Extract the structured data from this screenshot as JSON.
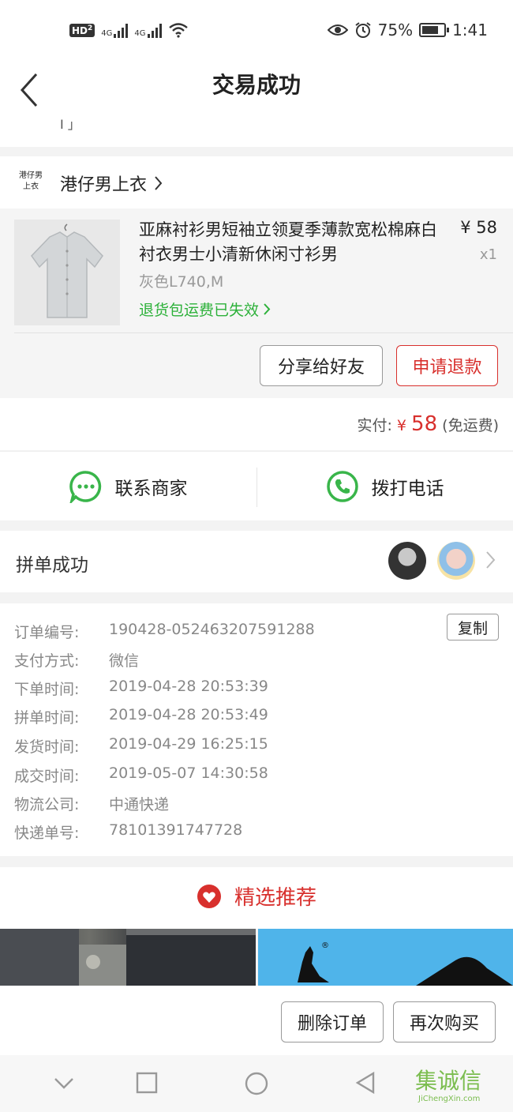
{
  "status_bar": {
    "hd_label": "HD",
    "hd_sub": "2",
    "net1": "4G",
    "net2": "4G",
    "battery_pct_text": "75%",
    "battery_level": 0.75,
    "time": "1:41"
  },
  "nav": {
    "title": "交易成功",
    "subtitle_fragment": "Ⅰ 」"
  },
  "shop": {
    "logo_text": "港仔男上衣",
    "name": "港仔男上衣"
  },
  "goods": {
    "title": "亚麻衬衫男短袖立领夏季薄款宽松棉麻白衬衣男士小清新休闲寸衫男",
    "price": "¥ 58",
    "qty": "x1",
    "spec": "灰色L740,M",
    "return_notice": "退货包运费已失效",
    "share_label": "分享给好友",
    "refund_label": "申请退款"
  },
  "payment": {
    "paid_label": "实付:",
    "currency": "¥",
    "amount": "58",
    "shipping_note": "(免运费)"
  },
  "contact": {
    "merchant_label": "联系商家",
    "phone_label": "拨打电话"
  },
  "group": {
    "label": "拼单成功"
  },
  "order_info": {
    "copy_label": "复制",
    "rows": [
      {
        "k": "订单编号:",
        "v": "190428-052463207591288"
      },
      {
        "k": "支付方式:",
        "v": "微信"
      },
      {
        "k": "下单时间:",
        "v": "2019-04-28 20:53:39"
      },
      {
        "k": "拼单时间:",
        "v": "2019-04-28 20:53:49"
      },
      {
        "k": "发货时间:",
        "v": "2019-04-29 16:25:15"
      },
      {
        "k": "成交时间:",
        "v": "2019-05-07 14:30:58"
      },
      {
        "k": "物流公司:",
        "v": "中通快递"
      },
      {
        "k": "快递单号:",
        "v": "78101391747728"
      }
    ]
  },
  "recommend": {
    "title": "精选推荐"
  },
  "bottom": {
    "delete_label": "删除订单",
    "rebuy_label": "再次购买"
  },
  "watermark": {
    "text": "集诚信",
    "domain": "JiChengXin.com"
  },
  "colors": {
    "accent_red": "#d8302d",
    "green": "#2db13a",
    "wechat_green": "#39b54a"
  }
}
